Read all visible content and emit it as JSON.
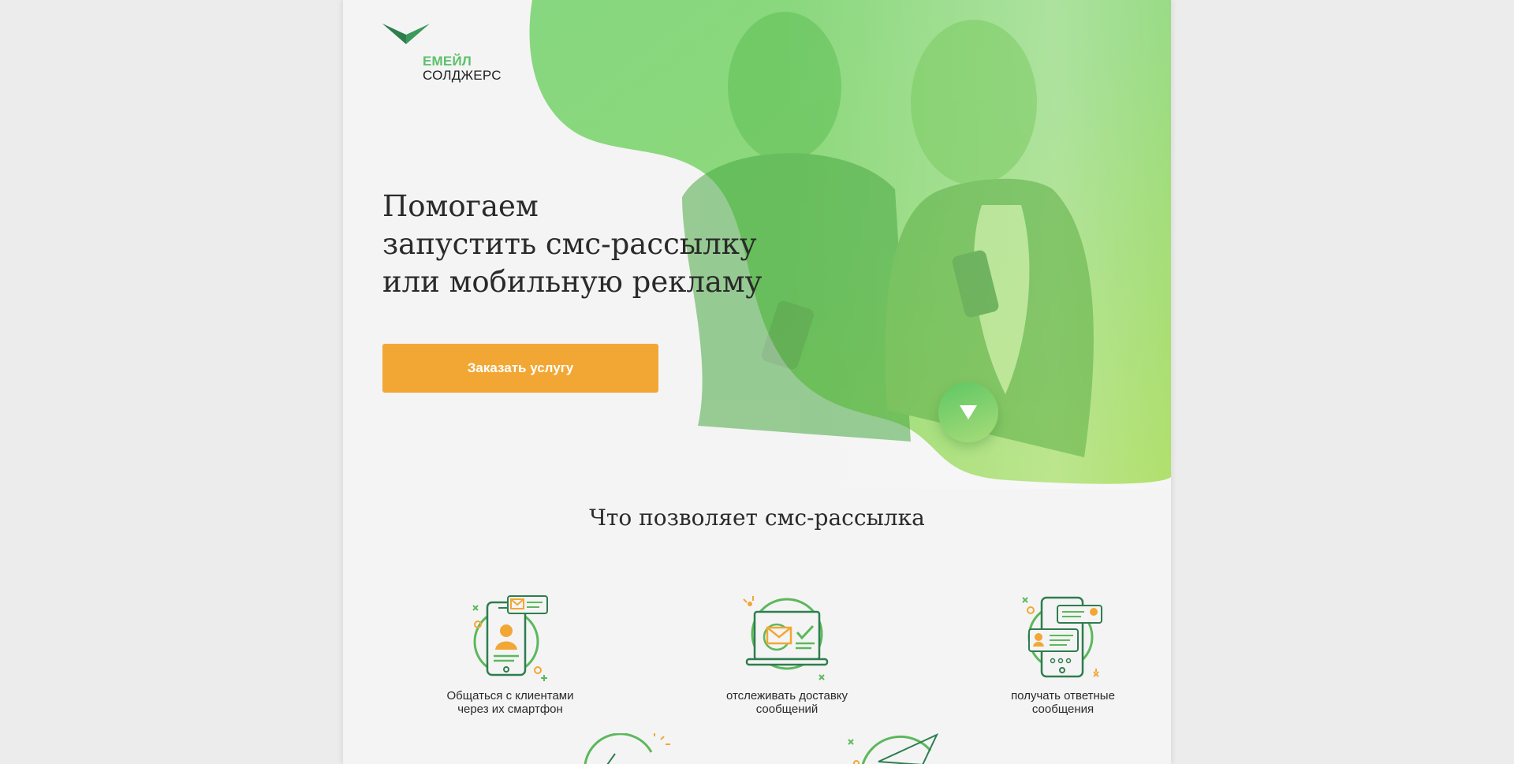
{
  "brand": {
    "line1": "ЕМЕЙЛ",
    "line2": "СОЛДЖЕРС",
    "color_green": "#5cc06b",
    "color_dark_green": "#2e7d4f"
  },
  "hero": {
    "headline": [
      "Помогаем",
      "запустить смс-рассылку",
      "или мобильную рекламу"
    ],
    "cta_label": "Заказать услугу",
    "cta_color": "#f2a735",
    "scroll_icon": "triangle-down-icon"
  },
  "features_section": {
    "title": "Что позволяет смс-рассылка",
    "items": [
      {
        "icon": "smartphone-chat-icon",
        "caption": [
          "Общаться с клиентами",
          "через их смартфон"
        ]
      },
      {
        "icon": "laptop-delivery-check-icon",
        "caption": [
          "отслеживать доставку",
          "сообщений"
        ]
      },
      {
        "icon": "phone-reply-messages-icon",
        "caption": [
          "получать ответные",
          "сообщения"
        ]
      }
    ]
  },
  "colors": {
    "page_bg": "#f4f4f4",
    "outer_bg": "#ececec",
    "icon_green": "#5cb85c",
    "icon_orange": "#f2a735"
  }
}
